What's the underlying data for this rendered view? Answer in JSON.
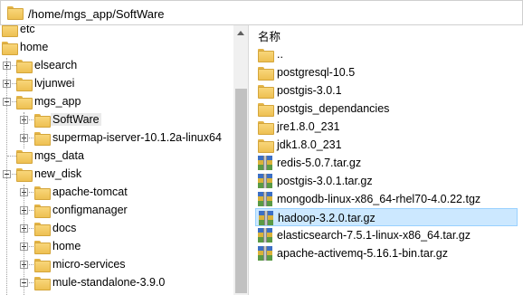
{
  "path_bar": {
    "path": "/home/mgs_app/SoftWare",
    "icon": "folder-icon"
  },
  "tree": {
    "items": [
      {
        "label": "etc",
        "level": 0,
        "expander": "none"
      },
      {
        "label": "home",
        "level": 0,
        "expander": "none"
      },
      {
        "label": "elsearch",
        "level": 1,
        "expander": "plus"
      },
      {
        "label": "lvjunwei",
        "level": 1,
        "expander": "plus"
      },
      {
        "label": "mgs_app",
        "level": 1,
        "expander": "minus"
      },
      {
        "label": "SoftWare",
        "level": 2,
        "expander": "plus",
        "selected": true
      },
      {
        "label": "supermap-iserver-10.1.2a-linux64",
        "level": 2,
        "expander": "plus"
      },
      {
        "label": "mgs_data",
        "level": 1,
        "expander": "none"
      },
      {
        "label": "new_disk",
        "level": 1,
        "expander": "minus"
      },
      {
        "label": "apache-tomcat",
        "level": 2,
        "expander": "plus"
      },
      {
        "label": "configmanager",
        "level": 2,
        "expander": "plus"
      },
      {
        "label": "docs",
        "level": 2,
        "expander": "plus"
      },
      {
        "label": "home",
        "level": 2,
        "expander": "plus"
      },
      {
        "label": "micro-services",
        "level": 2,
        "expander": "plus"
      },
      {
        "label": "mule-standalone-3.9.0",
        "level": 2,
        "expander": "minus"
      }
    ]
  },
  "file_list": {
    "column_header": "名称",
    "items": [
      {
        "name": "..",
        "type": "folder"
      },
      {
        "name": "postgresql-10.5",
        "type": "folder"
      },
      {
        "name": "postgis-3.0.1",
        "type": "folder"
      },
      {
        "name": "postgis_dependancies",
        "type": "folder"
      },
      {
        "name": "jre1.8.0_231",
        "type": "folder"
      },
      {
        "name": "jdk1.8.0_231",
        "type": "folder"
      },
      {
        "name": "redis-5.0.7.tar.gz",
        "type": "archive"
      },
      {
        "name": "postgis-3.0.1.tar.gz",
        "type": "archive"
      },
      {
        "name": "mongodb-linux-x86_64-rhel70-4.0.22.tgz",
        "type": "archive"
      },
      {
        "name": "hadoop-3.2.0.tar.gz",
        "type": "archive",
        "selected": true
      },
      {
        "name": "elasticsearch-7.5.1-linux-x86_64.tar.gz",
        "type": "archive"
      },
      {
        "name": "apache-activemq-5.16.1-bin.tar.gz",
        "type": "archive"
      }
    ]
  },
  "colors": {
    "selection_bg": "#cce8ff",
    "selection_border": "#99d1ff",
    "folder": "#eec052"
  }
}
